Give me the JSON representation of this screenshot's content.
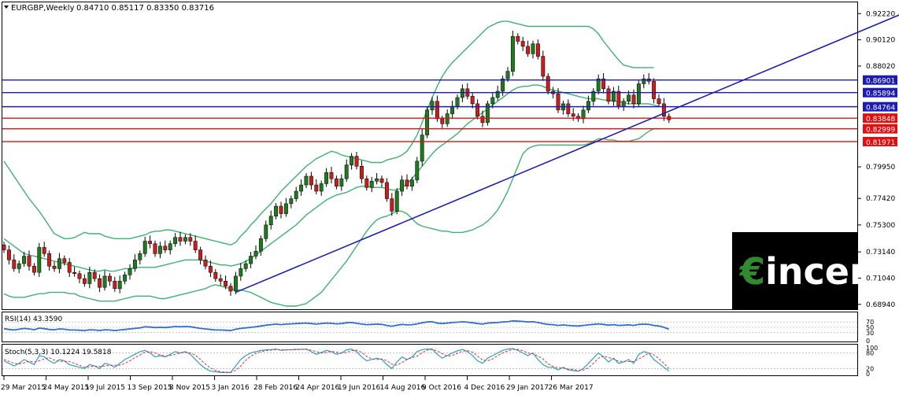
{
  "header": {
    "symbol": "EURGBP,Weekly",
    "ohlc": "0.84710 0.85117 0.83350 0.83716"
  },
  "colors": {
    "bull": "#1f7a1f",
    "bear": "#c81e1e",
    "bollinger": "#3cb371",
    "trendline": "#1c1cb4",
    "hline_blue": "#1c1cb4",
    "hline_red": "#e01010",
    "rsi": "#2c6fd6",
    "stoch_main": "#2aa0c8",
    "stoch_signal": "#e03030"
  },
  "logo": {
    "text": "€incen"
  },
  "chart_data": {
    "type": "candlestick",
    "price_axis": {
      "ylim": [
        0.6855,
        0.9312
      ],
      "ticks": [
        "0.92220",
        "0.90120",
        "0.88020",
        "0.85894",
        "0.84764",
        "0.83848",
        "0.82999",
        "0.81971",
        "0.79950",
        "0.77420",
        "0.75300",
        "0.73140",
        "0.71040",
        "0.68940"
      ]
    },
    "x_labels": [
      "29 Mar 2015",
      "24 May 2015",
      "19 Jul 2015",
      "13 Sep 2015",
      "8 Nov 2015",
      "3 Jan 2016",
      "28 Feb 2016",
      "24 Apr 2016",
      "19 Jun 2016",
      "14 Aug 2016",
      "9 Oct 2016",
      "4 Dec 2016",
      "29 Jan 2017",
      "26 Mar 2017"
    ],
    "horizontal_levels": [
      {
        "value": "0.86901",
        "price": 0.86901,
        "color": "blue"
      },
      {
        "value": "0.85894",
        "price": 0.85894,
        "color": "blue"
      },
      {
        "value": "0.84764",
        "price": 0.84764,
        "color": "blue"
      },
      {
        "value": "0.83848",
        "price": 0.83848,
        "color": "red"
      },
      {
        "value": "0.82999",
        "price": 0.82999,
        "color": "red"
      },
      {
        "value": "0.81971",
        "price": 0.81971,
        "color": "red"
      }
    ],
    "trendline": {
      "from_bar": 46,
      "from_price": 0.699,
      "to_bar": 180,
      "to_price": 0.925
    },
    "close": [
      0.733,
      0.725,
      0.718,
      0.722,
      0.728,
      0.72,
      0.715,
      0.735,
      0.73,
      0.72,
      0.718,
      0.726,
      0.723,
      0.715,
      0.714,
      0.71,
      0.706,
      0.715,
      0.71,
      0.703,
      0.712,
      0.708,
      0.702,
      0.708,
      0.713,
      0.718,
      0.725,
      0.73,
      0.74,
      0.738,
      0.73,
      0.736,
      0.733,
      0.738,
      0.743,
      0.74,
      0.743,
      0.74,
      0.733,
      0.725,
      0.72,
      0.715,
      0.71,
      0.708,
      0.704,
      0.7,
      0.712,
      0.718,
      0.722,
      0.728,
      0.732,
      0.742,
      0.753,
      0.76,
      0.768,
      0.762,
      0.77,
      0.774,
      0.78,
      0.785,
      0.792,
      0.785,
      0.78,
      0.786,
      0.795,
      0.79,
      0.784,
      0.79,
      0.801,
      0.808,
      0.8,
      0.79,
      0.783,
      0.788,
      0.79,
      0.787,
      0.774,
      0.764,
      0.78,
      0.789,
      0.784,
      0.789,
      0.804,
      0.825,
      0.845,
      0.852,
      0.838,
      0.834,
      0.842,
      0.848,
      0.855,
      0.862,
      0.856,
      0.85,
      0.84,
      0.835,
      0.85,
      0.855,
      0.86,
      0.87,
      0.876,
      0.904,
      0.9,
      0.896,
      0.89,
      0.898,
      0.888,
      0.872,
      0.86,
      0.858,
      0.845,
      0.85,
      0.842,
      0.84,
      0.838,
      0.845,
      0.852,
      0.86,
      0.87,
      0.862,
      0.852,
      0.86,
      0.848,
      0.852,
      0.857,
      0.85,
      0.866,
      0.87,
      0.868,
      0.854,
      0.85,
      0.84,
      0.8372
    ],
    "bb_upper": [
      0.804,
      0.798,
      0.792,
      0.786,
      0.78,
      0.774,
      0.769,
      0.764,
      0.758,
      0.752,
      0.746,
      0.744,
      0.742,
      0.742,
      0.743,
      0.745,
      0.747,
      0.746,
      0.746,
      0.746,
      0.744,
      0.743,
      0.742,
      0.742,
      0.742,
      0.742,
      0.743,
      0.744,
      0.745,
      0.747,
      0.748,
      0.748,
      0.749,
      0.749,
      0.748,
      0.747,
      0.746,
      0.745,
      0.744,
      0.743,
      0.742,
      0.741,
      0.74,
      0.739,
      0.738,
      0.737,
      0.739,
      0.744,
      0.748,
      0.753,
      0.757,
      0.762,
      0.766,
      0.77,
      0.775,
      0.78,
      0.784,
      0.788,
      0.792,
      0.796,
      0.8,
      0.803,
      0.806,
      0.808,
      0.81,
      0.812,
      0.811,
      0.809,
      0.808,
      0.807,
      0.806,
      0.805,
      0.804,
      0.803,
      0.803,
      0.803,
      0.805,
      0.806,
      0.807,
      0.809,
      0.812,
      0.818,
      0.825,
      0.835,
      0.845,
      0.855,
      0.864,
      0.872,
      0.878,
      0.883,
      0.887,
      0.891,
      0.895,
      0.899,
      0.903,
      0.907,
      0.911,
      0.913,
      0.915,
      0.916,
      0.916,
      0.915,
      0.914,
      0.913,
      0.912,
      0.912,
      0.912,
      0.912,
      0.912,
      0.912,
      0.912,
      0.912,
      0.912,
      0.912,
      0.912,
      0.912,
      0.912,
      0.91,
      0.906,
      0.9,
      0.895,
      0.89,
      0.885,
      0.881,
      0.88,
      0.879,
      0.879,
      0.879,
      0.879,
      0.879
    ],
    "bb_middle": [
      0.742,
      0.739,
      0.736,
      0.733,
      0.73,
      0.729,
      0.728,
      0.727,
      0.726,
      0.725,
      0.724,
      0.723,
      0.722,
      0.721,
      0.72,
      0.719,
      0.718,
      0.717,
      0.716,
      0.716,
      0.717,
      0.716,
      0.716,
      0.717,
      0.718,
      0.718,
      0.719,
      0.719,
      0.719,
      0.719,
      0.719,
      0.72,
      0.721,
      0.722,
      0.723,
      0.724,
      0.725,
      0.725,
      0.725,
      0.725,
      0.724,
      0.723,
      0.722,
      0.721,
      0.721,
      0.72,
      0.721,
      0.722,
      0.724,
      0.726,
      0.729,
      0.732,
      0.735,
      0.738,
      0.741,
      0.744,
      0.747,
      0.75,
      0.753,
      0.757,
      0.761,
      0.764,
      0.767,
      0.77,
      0.773,
      0.775,
      0.777,
      0.778,
      0.779,
      0.781,
      0.783,
      0.784,
      0.784,
      0.783,
      0.783,
      0.783,
      0.782,
      0.781,
      0.781,
      0.783,
      0.786,
      0.79,
      0.795,
      0.8,
      0.805,
      0.81,
      0.814,
      0.817,
      0.82,
      0.823,
      0.826,
      0.83,
      0.834,
      0.837,
      0.84,
      0.843,
      0.846,
      0.849,
      0.852,
      0.855,
      0.858,
      0.861,
      0.863,
      0.864,
      0.864,
      0.865,
      0.865,
      0.864,
      0.862,
      0.861,
      0.86,
      0.859,
      0.858,
      0.857,
      0.856,
      0.855,
      0.854,
      0.854,
      0.854,
      0.853,
      0.853,
      0.852,
      0.852,
      0.851,
      0.85,
      0.85,
      0.85,
      0.85,
      0.85,
      0.849,
      0.848
    ],
    "bb_lower": [
      0.698,
      0.696,
      0.695,
      0.695,
      0.695,
      0.696,
      0.697,
      0.698,
      0.698,
      0.699,
      0.699,
      0.699,
      0.699,
      0.698,
      0.698,
      0.696,
      0.695,
      0.694,
      0.693,
      0.692,
      0.692,
      0.692,
      0.692,
      0.693,
      0.694,
      0.695,
      0.696,
      0.696,
      0.696,
      0.696,
      0.695,
      0.694,
      0.694,
      0.695,
      0.696,
      0.697,
      0.698,
      0.699,
      0.7,
      0.701,
      0.702,
      0.704,
      0.705,
      0.704,
      0.703,
      0.702,
      0.701,
      0.701,
      0.7,
      0.699,
      0.697,
      0.695,
      0.693,
      0.691,
      0.69,
      0.689,
      0.688,
      0.688,
      0.688,
      0.689,
      0.69,
      0.693,
      0.696,
      0.699,
      0.704,
      0.709,
      0.714,
      0.719,
      0.724,
      0.73,
      0.736,
      0.742,
      0.748,
      0.753,
      0.757,
      0.759,
      0.76,
      0.762,
      0.764,
      0.764,
      0.762,
      0.758,
      0.754,
      0.752,
      0.751,
      0.75,
      0.749,
      0.748,
      0.748,
      0.747,
      0.747,
      0.747,
      0.748,
      0.749,
      0.751,
      0.753,
      0.756,
      0.76,
      0.765,
      0.772,
      0.78,
      0.79,
      0.8,
      0.81,
      0.814,
      0.816,
      0.817,
      0.817,
      0.817,
      0.817,
      0.817,
      0.817,
      0.817,
      0.817,
      0.817,
      0.817,
      0.818,
      0.82,
      0.822,
      0.822,
      0.821,
      0.821,
      0.82,
      0.82,
      0.82,
      0.821,
      0.822,
      0.825,
      0.828,
      0.83,
      0.83
    ],
    "rsi": {
      "label": "RSI(14) 43.3590",
      "levels": [
        "70",
        "50",
        "30",
        "0"
      ],
      "values": [
        45,
        42,
        40,
        43,
        46,
        44,
        41,
        47,
        45,
        42,
        41,
        44,
        43,
        40,
        40,
        39,
        38,
        41,
        40,
        38,
        41,
        40,
        38,
        40,
        42,
        44,
        46,
        48,
        52,
        51,
        49,
        50,
        49,
        51,
        53,
        52,
        53,
        52,
        49,
        46,
        44,
        42,
        40,
        40,
        39,
        38,
        43,
        46,
        48,
        50,
        52,
        55,
        58,
        60,
        62,
        60,
        62,
        63,
        64,
        65,
        66,
        64,
        62,
        64,
        66,
        65,
        63,
        64,
        67,
        68,
        65,
        62,
        60,
        61,
        62,
        61,
        57,
        54,
        58,
        61,
        59,
        60,
        63,
        67,
        70,
        71,
        66,
        64,
        66,
        68,
        69,
        71,
        69,
        67,
        64,
        62,
        66,
        67,
        68,
        70,
        71,
        74,
        73,
        72,
        70,
        71,
        68,
        64,
        61,
        60,
        57,
        59,
        57,
        56,
        55,
        57,
        59,
        61,
        63,
        61,
        58,
        60,
        57,
        58,
        59,
        57,
        61,
        62,
        61,
        57,
        55,
        50,
        43
      ]
    },
    "stoch": {
      "label": "Stoch(5,3,3) 10.1224 19.5818",
      "levels": [
        "100",
        "80",
        "20",
        "0"
      ],
      "main": [
        50,
        40,
        30,
        40,
        55,
        45,
        35,
        70,
        65,
        50,
        40,
        55,
        50,
        35,
        30,
        25,
        20,
        35,
        30,
        20,
        40,
        35,
        25,
        40,
        55,
        65,
        75,
        85,
        90,
        80,
        65,
        70,
        65,
        75,
        85,
        80,
        85,
        75,
        55,
        35,
        20,
        10,
        8,
        5,
        5,
        5,
        30,
        55,
        70,
        80,
        85,
        90,
        92,
        93,
        95,
        90,
        92,
        93,
        94,
        94,
        95,
        85,
        75,
        82,
        90,
        85,
        75,
        80,
        92,
        95,
        85,
        65,
        50,
        55,
        60,
        55,
        35,
        20,
        45,
        65,
        55,
        65,
        85,
        93,
        95,
        95,
        75,
        60,
        70,
        80,
        88,
        94,
        85,
        70,
        50,
        40,
        60,
        70,
        80,
        90,
        95,
        97,
        90,
        80,
        70,
        80,
        55,
        35,
        25,
        25,
        15,
        25,
        15,
        12,
        10,
        20,
        40,
        60,
        80,
        65,
        45,
        60,
        40,
        45,
        55,
        40,
        75,
        85,
        80,
        55,
        40,
        25,
        10
      ],
      "signal": [
        55,
        48,
        40,
        38,
        42,
        48,
        45,
        50,
        57,
        62,
        52,
        48,
        48,
        47,
        40,
        32,
        25,
        27,
        29,
        28,
        30,
        32,
        33,
        33,
        40,
        50,
        62,
        72,
        83,
        85,
        80,
        72,
        68,
        70,
        75,
        80,
        83,
        80,
        72,
        55,
        37,
        22,
        13,
        8,
        6,
        5,
        13,
        30,
        52,
        68,
        78,
        85,
        89,
        91,
        93,
        93,
        92,
        92,
        93,
        94,
        94,
        91,
        85,
        80,
        82,
        86,
        83,
        80,
        82,
        89,
        91,
        82,
        67,
        57,
        55,
        57,
        50,
        37,
        33,
        43,
        55,
        62,
        68,
        81,
        91,
        94,
        88,
        77,
        68,
        70,
        79,
        87,
        89,
        83,
        68,
        53,
        50,
        57,
        70,
        80,
        88,
        94,
        94,
        89,
        80,
        77,
        68,
        57,
        38,
        28,
        22,
        22,
        18,
        17,
        12,
        14,
        23,
        40,
        60,
        68,
        63,
        57,
        48,
        48,
        47,
        47,
        57,
        67,
        80,
        73,
        58,
        40,
        20
      ]
    }
  }
}
